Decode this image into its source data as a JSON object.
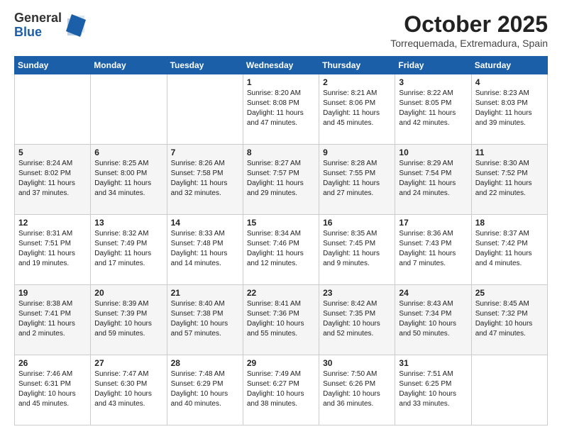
{
  "header": {
    "logo_general": "General",
    "logo_blue": "Blue",
    "month_title": "October 2025",
    "location": "Torrequemada, Extremadura, Spain"
  },
  "weekdays": [
    "Sunday",
    "Monday",
    "Tuesday",
    "Wednesday",
    "Thursday",
    "Friday",
    "Saturday"
  ],
  "weeks": [
    [
      {
        "day": "",
        "sunrise": "",
        "sunset": "",
        "daylight": ""
      },
      {
        "day": "",
        "sunrise": "",
        "sunset": "",
        "daylight": ""
      },
      {
        "day": "",
        "sunrise": "",
        "sunset": "",
        "daylight": ""
      },
      {
        "day": "1",
        "sunrise": "Sunrise: 8:20 AM",
        "sunset": "Sunset: 8:08 PM",
        "daylight": "Daylight: 11 hours and 47 minutes."
      },
      {
        "day": "2",
        "sunrise": "Sunrise: 8:21 AM",
        "sunset": "Sunset: 8:06 PM",
        "daylight": "Daylight: 11 hours and 45 minutes."
      },
      {
        "day": "3",
        "sunrise": "Sunrise: 8:22 AM",
        "sunset": "Sunset: 8:05 PM",
        "daylight": "Daylight: 11 hours and 42 minutes."
      },
      {
        "day": "4",
        "sunrise": "Sunrise: 8:23 AM",
        "sunset": "Sunset: 8:03 PM",
        "daylight": "Daylight: 11 hours and 39 minutes."
      }
    ],
    [
      {
        "day": "5",
        "sunrise": "Sunrise: 8:24 AM",
        "sunset": "Sunset: 8:02 PM",
        "daylight": "Daylight: 11 hours and 37 minutes."
      },
      {
        "day": "6",
        "sunrise": "Sunrise: 8:25 AM",
        "sunset": "Sunset: 8:00 PM",
        "daylight": "Daylight: 11 hours and 34 minutes."
      },
      {
        "day": "7",
        "sunrise": "Sunrise: 8:26 AM",
        "sunset": "Sunset: 7:58 PM",
        "daylight": "Daylight: 11 hours and 32 minutes."
      },
      {
        "day": "8",
        "sunrise": "Sunrise: 8:27 AM",
        "sunset": "Sunset: 7:57 PM",
        "daylight": "Daylight: 11 hours and 29 minutes."
      },
      {
        "day": "9",
        "sunrise": "Sunrise: 8:28 AM",
        "sunset": "Sunset: 7:55 PM",
        "daylight": "Daylight: 11 hours and 27 minutes."
      },
      {
        "day": "10",
        "sunrise": "Sunrise: 8:29 AM",
        "sunset": "Sunset: 7:54 PM",
        "daylight": "Daylight: 11 hours and 24 minutes."
      },
      {
        "day": "11",
        "sunrise": "Sunrise: 8:30 AM",
        "sunset": "Sunset: 7:52 PM",
        "daylight": "Daylight: 11 hours and 22 minutes."
      }
    ],
    [
      {
        "day": "12",
        "sunrise": "Sunrise: 8:31 AM",
        "sunset": "Sunset: 7:51 PM",
        "daylight": "Daylight: 11 hours and 19 minutes."
      },
      {
        "day": "13",
        "sunrise": "Sunrise: 8:32 AM",
        "sunset": "Sunset: 7:49 PM",
        "daylight": "Daylight: 11 hours and 17 minutes."
      },
      {
        "day": "14",
        "sunrise": "Sunrise: 8:33 AM",
        "sunset": "Sunset: 7:48 PM",
        "daylight": "Daylight: 11 hours and 14 minutes."
      },
      {
        "day": "15",
        "sunrise": "Sunrise: 8:34 AM",
        "sunset": "Sunset: 7:46 PM",
        "daylight": "Daylight: 11 hours and 12 minutes."
      },
      {
        "day": "16",
        "sunrise": "Sunrise: 8:35 AM",
        "sunset": "Sunset: 7:45 PM",
        "daylight": "Daylight: 11 hours and 9 minutes."
      },
      {
        "day": "17",
        "sunrise": "Sunrise: 8:36 AM",
        "sunset": "Sunset: 7:43 PM",
        "daylight": "Daylight: 11 hours and 7 minutes."
      },
      {
        "day": "18",
        "sunrise": "Sunrise: 8:37 AM",
        "sunset": "Sunset: 7:42 PM",
        "daylight": "Daylight: 11 hours and 4 minutes."
      }
    ],
    [
      {
        "day": "19",
        "sunrise": "Sunrise: 8:38 AM",
        "sunset": "Sunset: 7:41 PM",
        "daylight": "Daylight: 11 hours and 2 minutes."
      },
      {
        "day": "20",
        "sunrise": "Sunrise: 8:39 AM",
        "sunset": "Sunset: 7:39 PM",
        "daylight": "Daylight: 10 hours and 59 minutes."
      },
      {
        "day": "21",
        "sunrise": "Sunrise: 8:40 AM",
        "sunset": "Sunset: 7:38 PM",
        "daylight": "Daylight: 10 hours and 57 minutes."
      },
      {
        "day": "22",
        "sunrise": "Sunrise: 8:41 AM",
        "sunset": "Sunset: 7:36 PM",
        "daylight": "Daylight: 10 hours and 55 minutes."
      },
      {
        "day": "23",
        "sunrise": "Sunrise: 8:42 AM",
        "sunset": "Sunset: 7:35 PM",
        "daylight": "Daylight: 10 hours and 52 minutes."
      },
      {
        "day": "24",
        "sunrise": "Sunrise: 8:43 AM",
        "sunset": "Sunset: 7:34 PM",
        "daylight": "Daylight: 10 hours and 50 minutes."
      },
      {
        "day": "25",
        "sunrise": "Sunrise: 8:45 AM",
        "sunset": "Sunset: 7:32 PM",
        "daylight": "Daylight: 10 hours and 47 minutes."
      }
    ],
    [
      {
        "day": "26",
        "sunrise": "Sunrise: 7:46 AM",
        "sunset": "Sunset: 6:31 PM",
        "daylight": "Daylight: 10 hours and 45 minutes."
      },
      {
        "day": "27",
        "sunrise": "Sunrise: 7:47 AM",
        "sunset": "Sunset: 6:30 PM",
        "daylight": "Daylight: 10 hours and 43 minutes."
      },
      {
        "day": "28",
        "sunrise": "Sunrise: 7:48 AM",
        "sunset": "Sunset: 6:29 PM",
        "daylight": "Daylight: 10 hours and 40 minutes."
      },
      {
        "day": "29",
        "sunrise": "Sunrise: 7:49 AM",
        "sunset": "Sunset: 6:27 PM",
        "daylight": "Daylight: 10 hours and 38 minutes."
      },
      {
        "day": "30",
        "sunrise": "Sunrise: 7:50 AM",
        "sunset": "Sunset: 6:26 PM",
        "daylight": "Daylight: 10 hours and 36 minutes."
      },
      {
        "day": "31",
        "sunrise": "Sunrise: 7:51 AM",
        "sunset": "Sunset: 6:25 PM",
        "daylight": "Daylight: 10 hours and 33 minutes."
      },
      {
        "day": "",
        "sunrise": "",
        "sunset": "",
        "daylight": ""
      }
    ]
  ]
}
